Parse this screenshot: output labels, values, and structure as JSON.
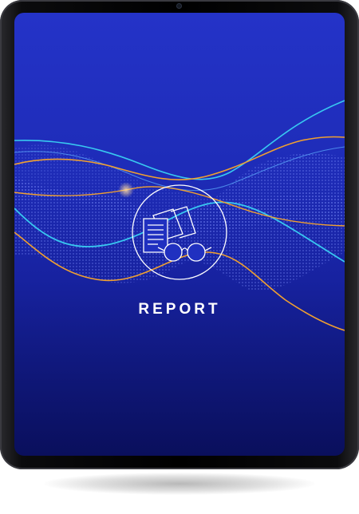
{
  "report": {
    "title": "REPORT"
  },
  "icons": [
    "report-documents-glasses-icon"
  ],
  "colors": {
    "screen_top": "#2433c8",
    "screen_bottom": "#0a0f5c",
    "wave_cyan": "#38c8f0",
    "wave_orange": "#f0a030",
    "device_frame": "#000000"
  }
}
